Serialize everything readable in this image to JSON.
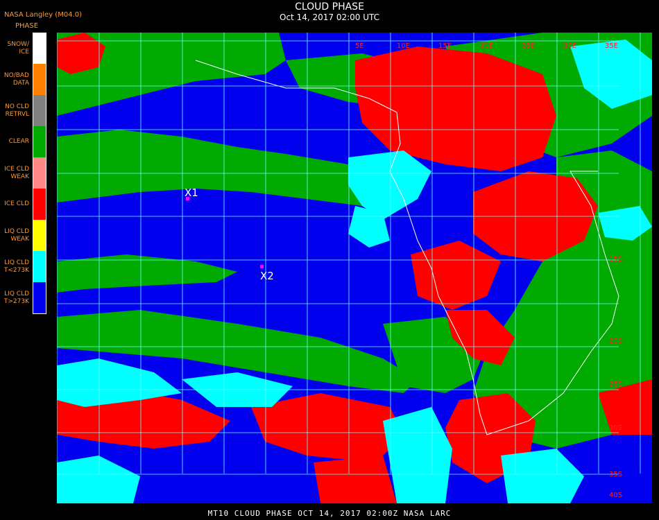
{
  "header": {
    "agency": "NASA Langley (M04.0)",
    "title": "CLOUD PHASE",
    "subtitle": "Oct 14, 2017 02:00 UTC",
    "legend_title": "PHASE"
  },
  "legend": [
    {
      "label": "SNOW/\nICE",
      "color": "#ffffff"
    },
    {
      "label": "NO/BAD\nDATA",
      "color": "#ff7f00"
    },
    {
      "label": "NO CLD\nRETRVL",
      "color": "#808080"
    },
    {
      "label": "CLEAR",
      "color": "#00aa00"
    },
    {
      "label": "ICE CLD\nWEAK",
      "color": "#ff8888"
    },
    {
      "label": "ICE CLD",
      "color": "#ff0000"
    },
    {
      "label": "LIQ CLD\nWEAK",
      "color": "#ffff00"
    },
    {
      "label": "LIQ CLD\nT<273K",
      "color": "#00ffff"
    },
    {
      "label": "LIQ CLD\nT>273K",
      "color": "#0000ee"
    }
  ],
  "map": {
    "grid_color": "#66ffff",
    "top_labels": [
      "5E",
      "10E",
      "15E",
      "20E",
      "25E",
      "30E",
      "35E"
    ],
    "right_labels": [
      "15S",
      "20S",
      "25S",
      "30S",
      "35S",
      "40S"
    ],
    "markers": [
      {
        "label": "X1",
        "color": "#ff00ff"
      },
      {
        "label": "X2",
        "color": "#ff00ff"
      }
    ]
  },
  "footer": {
    "text": "MT10  CLOUD PHASE  OCT 14, 2017 02:00Z  NASA LARC"
  }
}
